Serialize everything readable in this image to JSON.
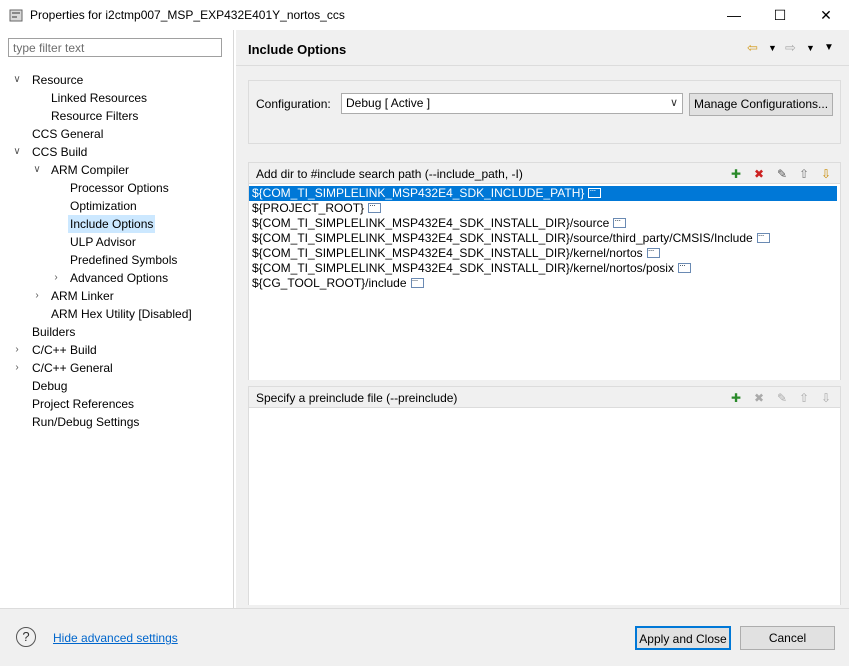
{
  "window": {
    "title": "Properties for i2ctmp007_MSP_EXP432E401Y_nortos_ccs",
    "controls": [
      "minimize-icon",
      "maximize-icon",
      "close-icon"
    ]
  },
  "left": {
    "filter_placeholder": "type filter text",
    "tree": [
      {
        "label": "Resource",
        "expanded": true
      },
      {
        "label": "Linked Resources"
      },
      {
        "label": "Resource Filters"
      },
      {
        "label": "CCS General"
      },
      {
        "label": "CCS Build",
        "expanded": true
      },
      {
        "label": "ARM Compiler",
        "expanded": true
      },
      {
        "label": "Processor Options"
      },
      {
        "label": "Optimization"
      },
      {
        "label": "Include Options",
        "selected": true
      },
      {
        "label": "ULP Advisor"
      },
      {
        "label": "Predefined Symbols"
      },
      {
        "label": "Advanced Options",
        "expanded": false
      },
      {
        "label": "ARM Linker",
        "expanded": false
      },
      {
        "label": "ARM Hex Utility  [Disabled]"
      },
      {
        "label": "Builders"
      },
      {
        "label": "C/C++ Build",
        "expanded": false
      },
      {
        "label": "C/C++ General",
        "expanded": false
      },
      {
        "label": "Debug"
      },
      {
        "label": "Project References"
      },
      {
        "label": "Run/Debug Settings"
      }
    ]
  },
  "page": {
    "title": "Include Options",
    "nav_icons": [
      "back-arrow-icon",
      "chevron-down-icon",
      "forward-arrow-icon",
      "chevron-down-icon",
      "view-menu-icon"
    ]
  },
  "config": {
    "label": "Configuration:",
    "selected": "Debug  [ Active ]",
    "manage_label": "Manage Configurations..."
  },
  "include_paths": {
    "title": "Add dir to #include search path (--include_path, -I)",
    "items": [
      "${COM_TI_SIMPLELINK_MSP432E4_SDK_INCLUDE_PATH}",
      "${PROJECT_ROOT}",
      "${COM_TI_SIMPLELINK_MSP432E4_SDK_INSTALL_DIR}/source",
      "${COM_TI_SIMPLELINK_MSP432E4_SDK_INSTALL_DIR}/source/third_party/CMSIS/Include",
      "${COM_TI_SIMPLELINK_MSP432E4_SDK_INSTALL_DIR}/kernel/nortos",
      "${COM_TI_SIMPLELINK_MSP432E4_SDK_INSTALL_DIR}/kernel/nortos/posix",
      "${CG_TOOL_ROOT}/include"
    ],
    "selected_index": 0
  },
  "preinclude": {
    "title": "Specify a preinclude file (--preinclude)",
    "items": []
  },
  "toolbar_icons": [
    "add-icon",
    "delete-icon",
    "edit-icon",
    "move-up-icon",
    "move-down-icon"
  ],
  "bottom": {
    "advanced_link": "Hide advanced settings",
    "apply_label": "Apply and Close",
    "cancel_label": "Cancel"
  },
  "colors": {
    "selection": "#0078d7",
    "tree_selection": "#cce8ff",
    "link": "#0066cc"
  }
}
